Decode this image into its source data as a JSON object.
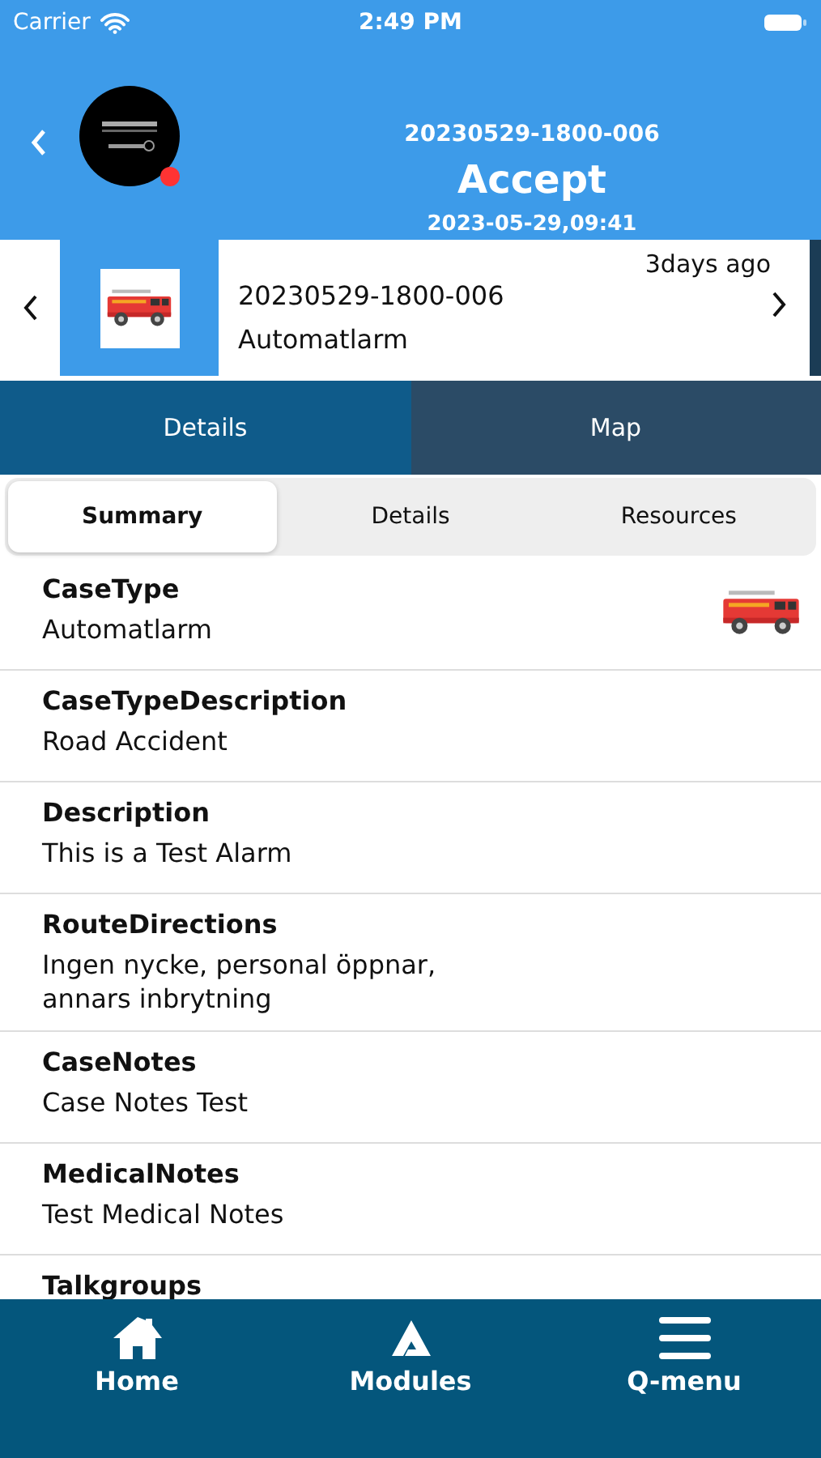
{
  "status_bar": {
    "carrier": "Carrier",
    "time": "2:49 PM"
  },
  "header": {
    "case_number": "20230529-1800-006",
    "status": "Accept",
    "datetime": "2023-05-29,09:41",
    "online": false
  },
  "case_card": {
    "age": "3days ago",
    "number": "20230529-1800-006",
    "type": "Automatlarm"
  },
  "tabs": [
    {
      "label": "Details",
      "selected": true
    },
    {
      "label": "Map",
      "selected": false
    }
  ],
  "segments": [
    {
      "label": "Summary",
      "selected": true
    },
    {
      "label": "Details",
      "selected": false
    },
    {
      "label": "Resources",
      "selected": false
    }
  ],
  "fields": [
    {
      "label": "CaseType",
      "value": "Automatlarm",
      "kind": "vehicle"
    },
    {
      "label": "CaseTypeDescription",
      "value": "Road Accident",
      "kind": "text"
    },
    {
      "label": "Description",
      "value": "This is a Test Alarm",
      "kind": "text"
    },
    {
      "label": "RouteDirections",
      "value": "Ingen nycke, personal öppnar,\nannars inbrytning",
      "kind": "text"
    },
    {
      "label": "CaseNotes",
      "value": "Case Notes Test",
      "kind": "text"
    },
    {
      "label": "MedicalNotes",
      "value": "Test Medical Notes",
      "kind": "text"
    },
    {
      "label": "Talkgroups",
      "kind": "text"
    }
  ],
  "bottom_nav": [
    {
      "label": "Home",
      "kind": "home"
    },
    {
      "label": "Modules",
      "kind": "modules"
    },
    {
      "label": "Q-menu",
      "kind": "menu"
    }
  ]
}
